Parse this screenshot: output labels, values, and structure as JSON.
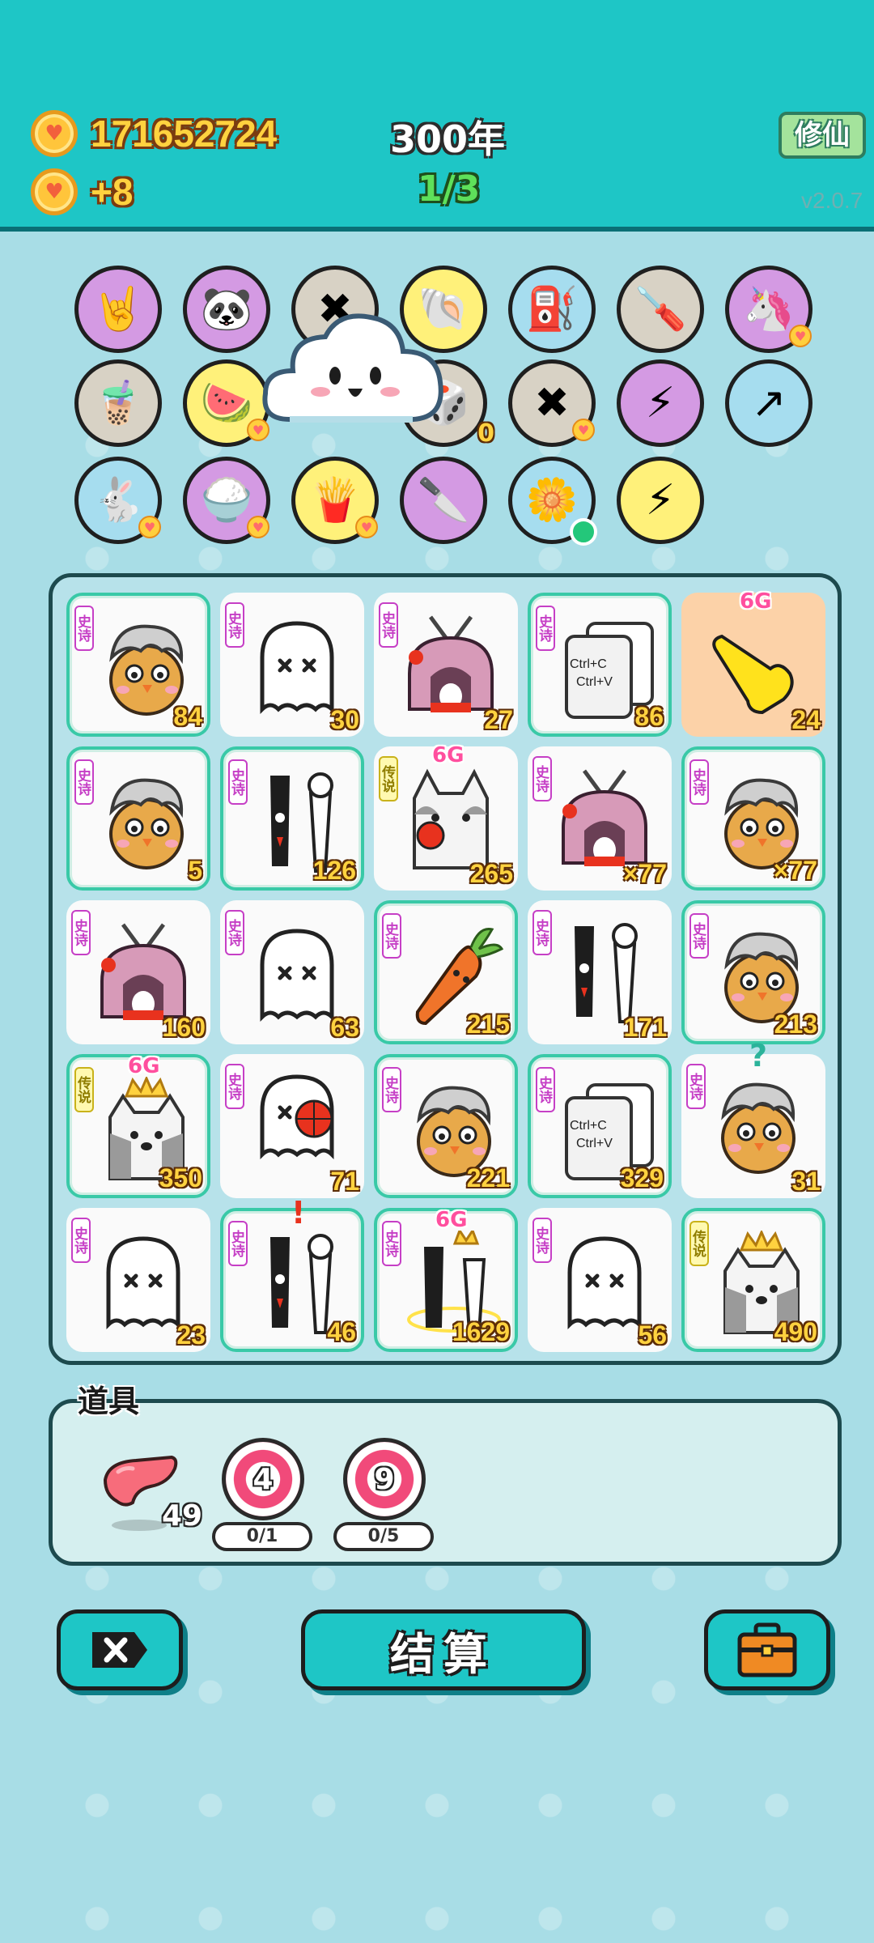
{
  "header": {
    "coins": "171652724",
    "coin_gain": "+8",
    "year": "300年",
    "progress": "1/3",
    "cultivate_label": "修仙",
    "version": "v2.0.7"
  },
  "orbs": {
    "row1": [
      {
        "icon": "rock-hand-icon",
        "glyph": "🤘",
        "color": "purple"
      },
      {
        "icon": "panda-icon",
        "glyph": "🐼",
        "color": "purple"
      },
      {
        "icon": "close-tag-icon",
        "glyph": "✖",
        "color": "grey"
      },
      {
        "icon": "shell-icon",
        "glyph": "🐚",
        "color": "yellow"
      },
      {
        "icon": "pump-icon",
        "glyph": "⛽",
        "color": "blue"
      },
      {
        "icon": "screwdriver-icon",
        "glyph": "🪛",
        "color": "grey"
      },
      {
        "icon": "unicorns-icon",
        "glyph": "🦄",
        "color": "purple"
      }
    ],
    "row2": [
      {
        "icon": "bubble-tea-icon",
        "glyph": "🧋",
        "color": "grey"
      },
      {
        "icon": "fruit-plate-icon",
        "glyph": "🍉",
        "color": "yellow"
      },
      {
        "icon": "dice-icon",
        "glyph": "🎲",
        "color": "grey",
        "count": "0"
      },
      {
        "icon": "close-tag-icon",
        "glyph": "✖",
        "color": "grey"
      },
      {
        "icon": "bird-lightning-icon",
        "glyph": "⚡",
        "color": "purple"
      },
      {
        "icon": "arrow-card-icon",
        "glyph": "↗",
        "color": "blue"
      }
    ],
    "row3": [
      {
        "icon": "rabbit-icon",
        "glyph": "🐇",
        "color": "blue"
      },
      {
        "icon": "rice-bowl-icon",
        "glyph": "🍚",
        "color": "purple"
      },
      {
        "icon": "fries-icon",
        "glyph": "🍟",
        "color": "yellow"
      },
      {
        "icon": "cleaver-icon",
        "glyph": "🔪",
        "color": "purple"
      },
      {
        "icon": "flower-pot-icon",
        "glyph": "🌼",
        "color": "blue"
      },
      {
        "icon": "lightning-icon",
        "glyph": "⚡",
        "color": "yellow"
      }
    ]
  },
  "rarity_labels": {
    "epic": "史诗",
    "legend": "传说"
  },
  "board": [
    [
      {
        "type": "bird",
        "rarity": "epic",
        "count": "84",
        "framed": true
      },
      {
        "type": "ghost",
        "rarity": "epic",
        "count": "30",
        "framed": false
      },
      {
        "type": "rabbit-house",
        "rarity": "epic",
        "count": "27",
        "framed": false
      },
      {
        "type": "copy-paste",
        "rarity": "epic",
        "count": "86",
        "framed": true
      },
      {
        "type": "pointing-hand",
        "rarity": "",
        "count": "24",
        "framed": false,
        "tag": "6G"
      }
    ],
    [
      {
        "type": "bird",
        "rarity": "epic",
        "count": "5",
        "framed": true
      },
      {
        "type": "ghost-pair",
        "rarity": "epic",
        "count": "126",
        "framed": true
      },
      {
        "type": "husky",
        "rarity": "legend",
        "count": "265",
        "framed": false,
        "tag": "6G"
      },
      {
        "type": "rabbit-house",
        "rarity": "epic",
        "count": "×77",
        "framed": false
      },
      {
        "type": "bird",
        "rarity": "epic",
        "count": "×77",
        "framed": true
      }
    ],
    [
      {
        "type": "rabbit-house",
        "rarity": "epic",
        "count": "160",
        "framed": false
      },
      {
        "type": "ghost",
        "rarity": "epic",
        "count": "63",
        "framed": false
      },
      {
        "type": "carrot",
        "rarity": "epic",
        "count": "215",
        "framed": true
      },
      {
        "type": "ghost-pair",
        "rarity": "epic",
        "count": "171",
        "framed": false
      },
      {
        "type": "bird",
        "rarity": "epic",
        "count": "213",
        "framed": true
      }
    ],
    [
      {
        "type": "husky-crown",
        "rarity": "legend",
        "count": "350",
        "framed": true,
        "tag": "6G"
      },
      {
        "type": "ghost-ball",
        "rarity": "epic",
        "count": "71",
        "framed": false
      },
      {
        "type": "bird",
        "rarity": "epic",
        "count": "221",
        "framed": true
      },
      {
        "type": "copy-paste",
        "rarity": "epic",
        "count": "329",
        "framed": true
      },
      {
        "type": "bird",
        "rarity": "epic",
        "count": "31",
        "framed": false,
        "mark": "?"
      }
    ],
    [
      {
        "type": "ghost",
        "rarity": "epic",
        "count": "23",
        "framed": false
      },
      {
        "type": "ghost-pair",
        "rarity": "epic",
        "count": "46",
        "framed": true,
        "mark": "!"
      },
      {
        "type": "ghost-pair-crown",
        "rarity": "epic",
        "count": "1629",
        "framed": true,
        "tag": "6G"
      },
      {
        "type": "ghost",
        "rarity": "epic",
        "count": "56",
        "framed": false
      },
      {
        "type": "husky-crown",
        "rarity": "legend",
        "count": "490",
        "framed": true
      }
    ]
  ],
  "copy_paste_text": {
    "line1": "Ctrl+C",
    "line2": "Ctrl+V"
  },
  "props": {
    "title": "道具",
    "liver_count": "49",
    "target1_number": "4",
    "target1_progress": "0/1",
    "target2_number": "9",
    "target2_progress": "0/5"
  },
  "buttons": {
    "settle_label": "结算"
  },
  "colors": {
    "header_teal": "#1ec6c6",
    "background": "#a8dde6",
    "frame_green": "#39c9a7",
    "count_gold": "#ffd23f",
    "epic_purple": "#c63fc6"
  }
}
